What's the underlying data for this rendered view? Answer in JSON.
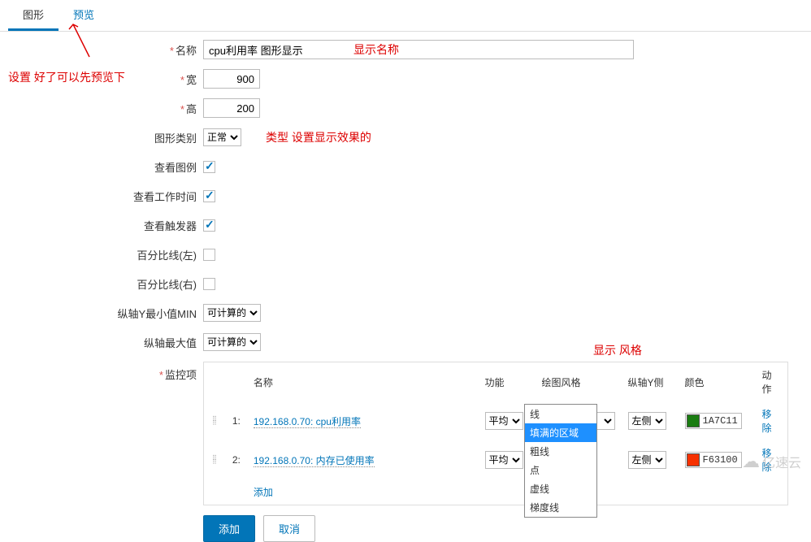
{
  "tabs": {
    "graph": "图形",
    "preview": "预览"
  },
  "annotations": {
    "preview_hint": "设置 好了可以先预览下",
    "display_name": "显示名称",
    "type_hint": "类型 设置显示效果的",
    "style_hint": "显示 风格"
  },
  "labels": {
    "name": "名称",
    "width": "宽",
    "height": "高",
    "graph_type": "图形类别",
    "show_legend": "查看图例",
    "show_work_time": "查看工作时间",
    "show_triggers": "查看触发器",
    "percent_left": "百分比线(左)",
    "percent_right": "百分比线(右)",
    "y_min": "纵轴Y最小值MIN",
    "y_max": "纵轴最大值",
    "items": "监控项"
  },
  "values": {
    "name": "cpu利用率 图形显示",
    "width": "900",
    "height": "200",
    "graph_type": "正常",
    "y_min": "可计算的",
    "y_max": "可计算的"
  },
  "items_header": {
    "name": "名称",
    "function": "功能",
    "draw_style": "绘图风格",
    "y_side": "纵轴Y侧",
    "color": "颜色",
    "action": "动作"
  },
  "items": [
    {
      "idx": "1:",
      "name": "192.168.0.70: cpu利用率",
      "function": "平均",
      "draw_style": "填满的区域",
      "y_side": "左侧",
      "color": "1A7C11",
      "color_hex": "#1A7C11",
      "action": "移除"
    },
    {
      "idx": "2:",
      "name": "192.168.0.70: 内存已使用率",
      "function": "平均",
      "draw_style": "填满的区域",
      "y_side": "左侧",
      "color": "F63100",
      "color_hex": "#F63100",
      "action": "移除"
    }
  ],
  "dropdown_options": {
    "line": "线",
    "filled": "填满的区域",
    "bold": "粗线",
    "dot": "点",
    "dashed": "虚线",
    "gradient": "梯度线"
  },
  "actions": {
    "add_item": "添加",
    "submit": "添加",
    "cancel": "取消"
  },
  "watermark": "亿速云"
}
